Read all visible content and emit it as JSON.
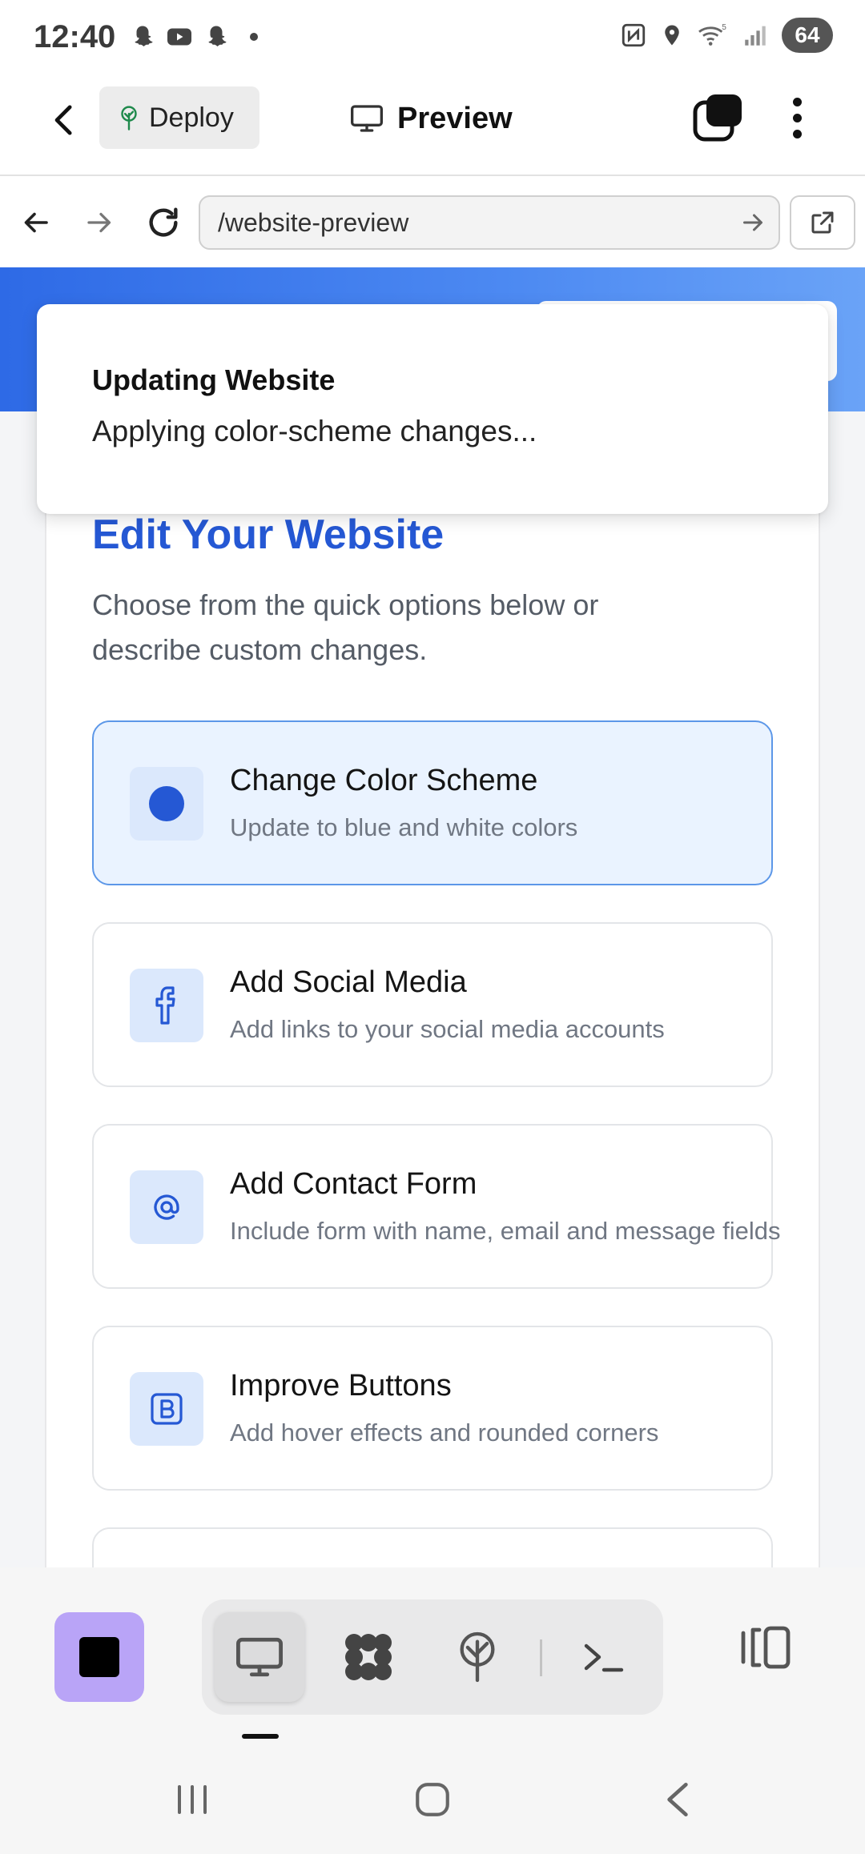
{
  "status_bar": {
    "time": "12:40",
    "battery": "64"
  },
  "header": {
    "deploy_label": "Deploy",
    "preview_label": "Preview"
  },
  "browser": {
    "url": "/website-preview"
  },
  "toast": {
    "title": "Updating Website",
    "message": "Applying color-scheme changes..."
  },
  "editor": {
    "title": "Edit Your Website",
    "description": "Choose from the quick options below or describe custom changes.",
    "options": [
      {
        "title": "Change Color Scheme",
        "subtitle": "Update to blue and white colors",
        "icon": "color-dot-icon",
        "selected": true
      },
      {
        "title": "Add Social Media",
        "subtitle": "Add links to your social media accounts",
        "icon": "facebook-icon",
        "selected": false
      },
      {
        "title": "Add Contact Form",
        "subtitle": "Include form with name, email and message fields",
        "icon": "at-sign-icon",
        "selected": false
      },
      {
        "title": "Improve Buttons",
        "subtitle": "Add hover effects and rounded corners",
        "icon": "button-b-icon",
        "selected": false
      }
    ]
  },
  "colors": {
    "accent": "#2558d4",
    "selected_bg": "#eaf3ff",
    "stop_button": "#b9a4f7",
    "hero_gradient_start": "#2e6ae6"
  }
}
